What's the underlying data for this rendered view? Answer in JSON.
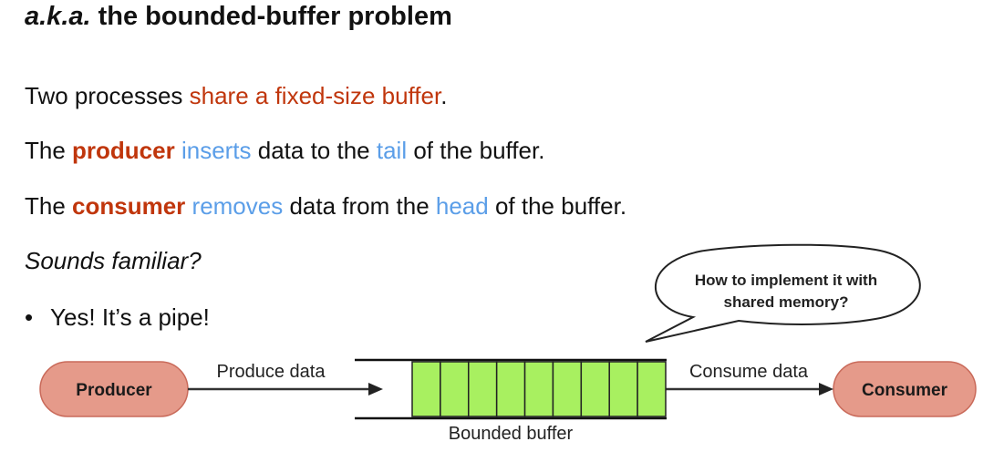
{
  "title": {
    "prefix": "a.k.a.",
    "rest": " the bounded-buffer problem"
  },
  "lines": {
    "l1": {
      "a": "Two processes ",
      "b": "share a fixed-size buffer",
      "c": "."
    },
    "l2": {
      "a": "The ",
      "b": "producer",
      "c": " ",
      "d": "inserts",
      "e": " data to the ",
      "f": "tail",
      "g": " of the buffer."
    },
    "l3": {
      "a": "The ",
      "b": "consumer",
      "c": " ",
      "d": "removes",
      "e": " data from the ",
      "f": "head",
      "g": " of the buffer."
    },
    "l4": "Sounds familiar?",
    "bullet": {
      "marker": "•",
      "text": "Yes! It’s a pipe!"
    }
  },
  "diagram": {
    "producer": "Producer",
    "consumer": "Consumer",
    "produce_label": "Produce data",
    "consume_label": "Consume data",
    "buffer_label": "Bounded buffer",
    "bubble_line1": "How to implement it with",
    "bubble_line2": "shared memory?",
    "buffer_slots": 9
  },
  "colors": {
    "red": "#c0360c",
    "blue": "#5b9ee8",
    "pill_fill": "#e59a8a",
    "pill_stroke": "#c96a5a",
    "slot_fill": "#a8f060"
  }
}
